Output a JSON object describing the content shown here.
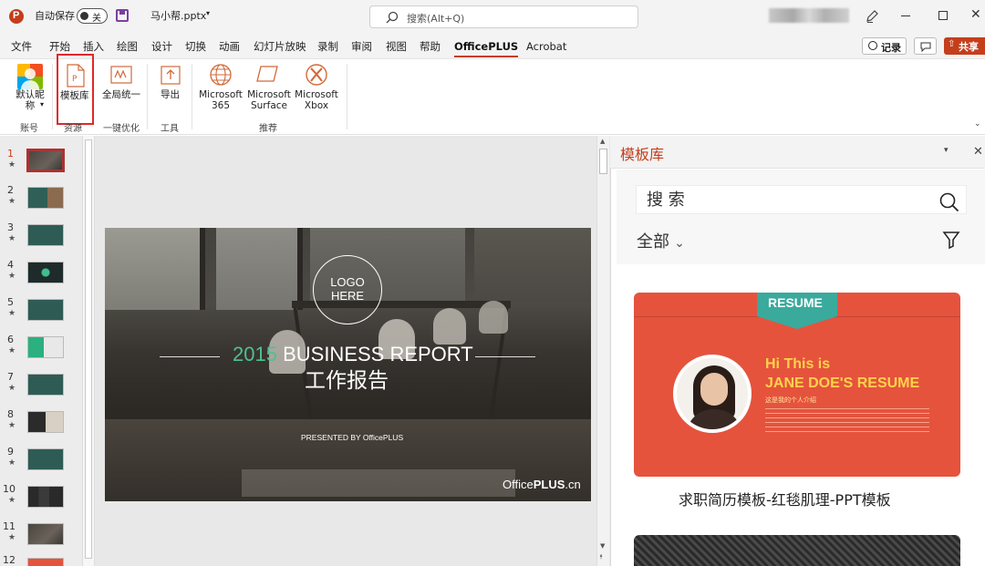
{
  "titlebar": {
    "autosave_label": "自动保存",
    "autosave_state": "关",
    "filename": "马小帮.pptx",
    "search_placeholder": "搜索(Alt+Q)"
  },
  "tabs": [
    "文件",
    "开始",
    "插入",
    "绘图",
    "设计",
    "切换",
    "动画",
    "幻灯片放映",
    "录制",
    "审阅",
    "视图",
    "帮助",
    "OfficePLUS",
    "Acrobat"
  ],
  "active_tab": "OfficePLUS",
  "top_right": {
    "record_label": "记录",
    "share_label": "共享"
  },
  "ribbon": {
    "buttons": {
      "default_nick": "默认昵称",
      "template_lib": "模板库",
      "unify": "全局统一",
      "export": "导出",
      "ms365_line1": "Microsoft",
      "ms365_line2": "365",
      "surface_line1": "Microsoft",
      "surface_line2": "Surface",
      "xbox_line1": "Microsoft",
      "xbox_line2": "Xbox"
    },
    "groups": {
      "account": "账号",
      "resources": "资源",
      "optimize": "一键优化",
      "tools": "工具",
      "recommend": "推荐"
    }
  },
  "slide_numbers": [
    "1",
    "2",
    "3",
    "4",
    "5",
    "6",
    "7",
    "8",
    "9",
    "10",
    "11",
    "12"
  ],
  "slide": {
    "logo_line1": "LOGO",
    "logo_line2": "HERE",
    "year": "2015",
    "title_en": "BUSINESS REPORT",
    "title_cn": "工作报告",
    "presented_by": "PRESENTED BY OfficePLUS",
    "brand_prefix": "Office",
    "brand_bold": "PLUS",
    "brand_suffix": ".cn"
  },
  "panel": {
    "title": "模板库",
    "search_placeholder": "搜 索",
    "filter_label": "全部",
    "card": {
      "ribbon_text": "RESUME",
      "hi_line": "Hi This is",
      "name_line": "JANE DOE'S RESUME",
      "sub_line": "这是我的个人介绍",
      "caption": "求职简历模板-红毯肌理-PPT模板"
    }
  },
  "colors": {
    "accent": "#c43e1c",
    "resume_red": "#e5533d",
    "teal": "#3aaa9c",
    "yellow": "#ffd24a",
    "slide_green": "#4fc08d"
  }
}
